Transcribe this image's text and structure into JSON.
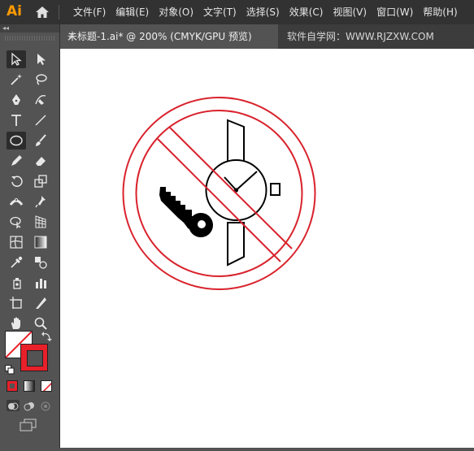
{
  "app": {
    "logo": "Ai",
    "menus": [
      "文件(F)",
      "编辑(E)",
      "对象(O)",
      "文字(T)",
      "选择(S)",
      "效果(C)",
      "视图(V)",
      "窗口(W)",
      "帮助(H)"
    ]
  },
  "tabs": {
    "active_label": "未标题-1.ai* @ 200% (CMYK/GPU 预览)",
    "close_glyph": "×",
    "second_label": "软件自学网：WWW.RJZXW.COM"
  },
  "toolbar": {
    "collapse_glyph": "◂◂",
    "tools": [
      "selection-tool",
      "direct-selection-tool",
      "magic-wand-tool",
      "lasso-tool",
      "pen-tool",
      "curvature-tool",
      "type-tool",
      "line-tool",
      "ellipse-tool",
      "paintbrush-tool",
      "pencil-tool",
      "eraser-tool",
      "rotate-tool",
      "scale-tool",
      "width-tool",
      "puppet-warp-tool",
      "shape-builder-tool",
      "perspective-grid-tool",
      "mesh-tool",
      "gradient-tool",
      "eyedropper-tool",
      "blend-tool",
      "symbol-sprayer-tool",
      "column-graph-tool",
      "artboard-tool",
      "slice-tool",
      "hand-tool",
      "zoom-tool"
    ]
  },
  "colors": {
    "fill": "#ffffff",
    "stroke": "#e8202a",
    "accent_red": "#d9232d"
  }
}
